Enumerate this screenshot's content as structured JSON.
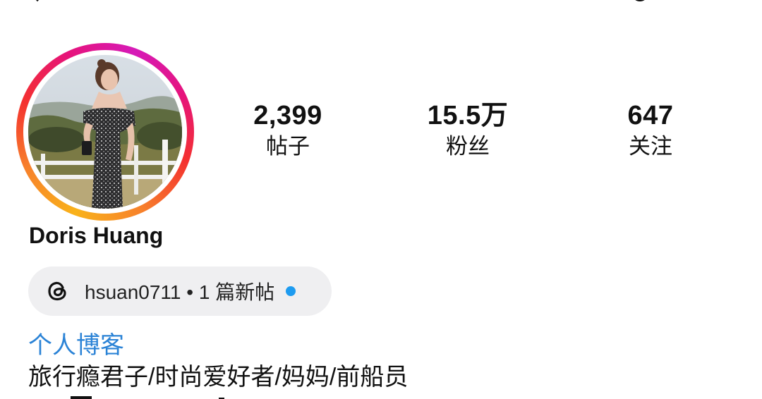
{
  "profile": {
    "display_name": "Doris Huang",
    "avatar": {
      "story_ring": true,
      "ring_colors": [
        "#f9b21a",
        "#f4312f",
        "#d61bb8"
      ]
    }
  },
  "stats": {
    "posts": {
      "value": "2,399",
      "label": "帖子"
    },
    "followers": {
      "value": "15.5万",
      "label": "粉丝"
    },
    "following": {
      "value": "647",
      "label": "关注"
    }
  },
  "threads_badge": {
    "icon": "threads-icon",
    "text": "hsuan0711 • 1 篇新帖",
    "unread_dot_color": "#1d9bf0"
  },
  "category": {
    "text": "个人博客",
    "color": "#2b83d6"
  },
  "bio": {
    "line1": "旅行瘾君子/时尚爱好者/妈妈/前船员"
  }
}
